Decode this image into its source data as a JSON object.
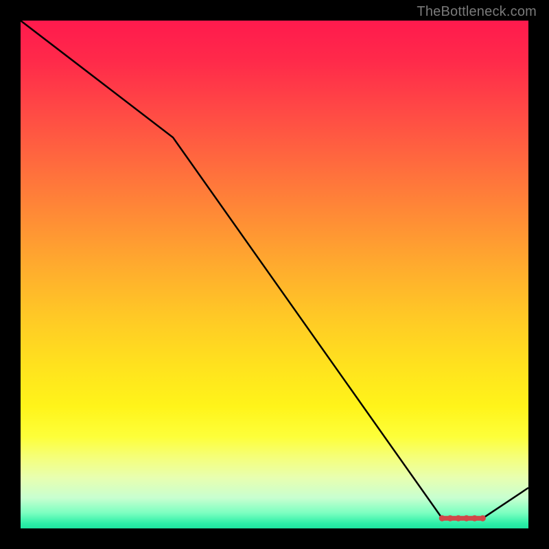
{
  "watermark": "TheBottleneck.com",
  "chart_data": {
    "type": "line",
    "title": "",
    "xlabel": "",
    "ylabel": "",
    "xlim": [
      0,
      100
    ],
    "ylim": [
      0,
      100
    ],
    "grid": false,
    "series": [
      {
        "name": "curve",
        "x": [
          0,
          30,
          83,
          91,
          100
        ],
        "values": [
          100,
          77,
          2,
          2,
          8
        ]
      }
    ],
    "markers": {
      "name": "bottom-segment",
      "x_start": 83,
      "x_end": 91,
      "y": 2,
      "color": "#d14848"
    },
    "background_gradient": {
      "top": "#ff1a4d",
      "mid": "#ffe21e",
      "bottom": "#1ee5a0"
    }
  }
}
